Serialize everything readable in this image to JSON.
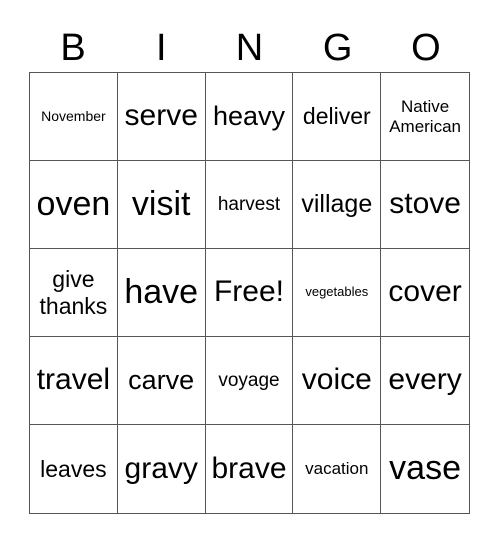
{
  "header": {
    "letters": [
      "B",
      "I",
      "N",
      "G",
      "O"
    ]
  },
  "board": {
    "rows": [
      [
        "November",
        "serve",
        "heavy",
        "deliver",
        "Native American"
      ],
      [
        "oven",
        "visit",
        "harvest",
        "village",
        "stove"
      ],
      [
        "give thanks",
        "have",
        "Free!",
        "vegetables",
        "cover"
      ],
      [
        "travel",
        "carve",
        "voyage",
        "voice",
        "every"
      ],
      [
        "leaves",
        "gravy",
        "brave",
        "vacation",
        "vase"
      ]
    ],
    "free_space": "Free!"
  }
}
